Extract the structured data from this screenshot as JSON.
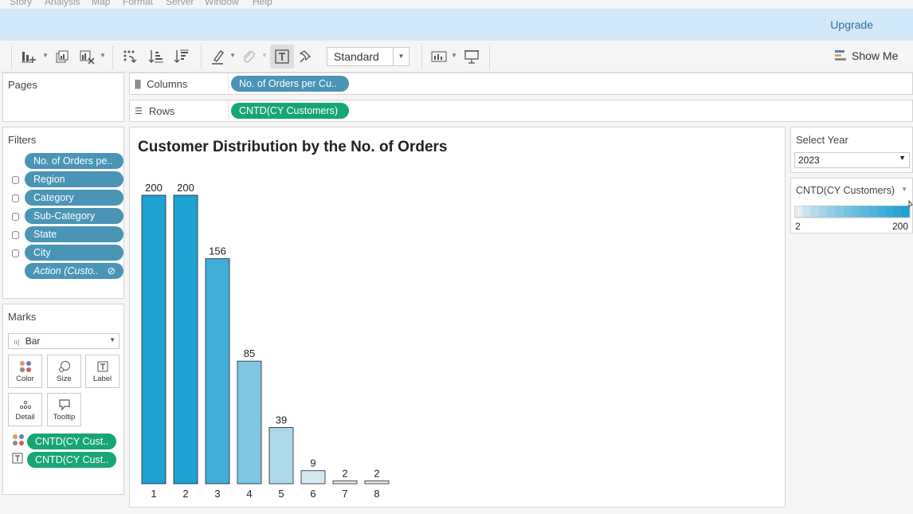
{
  "menu": [
    "Story",
    "Analysis",
    "Map",
    "Format",
    "Server",
    "Window",
    "Help"
  ],
  "banner": {
    "upgrade_label": "Upgrade"
  },
  "toolbar": {
    "mark_type_select": "Standard",
    "show_me_label": "Show Me"
  },
  "shelves": {
    "columns_label": "Columns",
    "columns_pill": "No. of Orders per Cu..",
    "rows_label": "Rows",
    "rows_pill": "CNTD(CY Customers)"
  },
  "pages": {
    "title": "Pages"
  },
  "filters": {
    "title": "Filters",
    "items": [
      "No. of Orders pe..",
      "Region",
      "Category",
      "Sub-Category",
      "State",
      "City",
      "Action (Custo.."
    ]
  },
  "marks": {
    "title": "Marks",
    "mark_type": "Bar",
    "cards": [
      "Color",
      "Size",
      "Label",
      "Detail",
      "Tooltip"
    ],
    "pills": [
      "CNTD(CY Cust..",
      "CNTD(CY Cust.."
    ]
  },
  "right_panel": {
    "select_year_title": "Select Year",
    "year_value": "2023",
    "legend_title": "CNTD(CY Customers)",
    "legend_min": "2",
    "legend_max": "200"
  },
  "colors": {
    "accent_blue": "#4a94b6",
    "accent_green": "#17a673",
    "banner": "#d3e8f8",
    "bar_dark": "#1ea1d3",
    "bar_light": "#e6eef3"
  },
  "chart_data": {
    "type": "bar",
    "title": "Customer Distribution by the No. of Orders",
    "categories": [
      "1",
      "2",
      "3",
      "4",
      "5",
      "6",
      "7",
      "8"
    ],
    "values": [
      200,
      200,
      156,
      85,
      39,
      9,
      2,
      2
    ],
    "ylim": [
      0,
      200
    ],
    "xlabel": "",
    "ylabel": "",
    "grid": false,
    "data_labels": true,
    "color_scale": {
      "min": 2,
      "max": 200,
      "low": "#e6eef3",
      "high": "#1ea1d3"
    }
  }
}
